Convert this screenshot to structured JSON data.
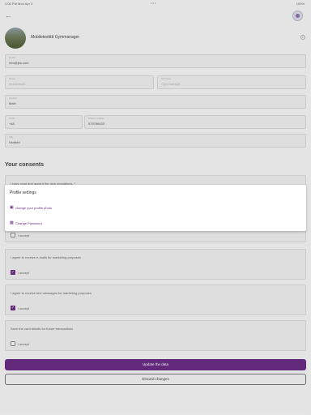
{
  "status_bar": {
    "time": "2:05 PM",
    "date": "Mon Apr 3",
    "dots": "•••",
    "battery": "100%"
  },
  "profile": {
    "name": "Mobiletesttttt Gymmanager"
  },
  "fields": {
    "email": {
      "label": "Email",
      "value": "mm@jhs.com"
    },
    "first_name": {
      "label": "Name",
      "value": "Mobiletesttt"
    },
    "last_name": {
      "label": "Surname",
      "value": "Gymmanager"
    },
    "gender": {
      "label": "Gender",
      "value": "Male"
    },
    "prefix": {
      "label": "Prefix",
      "value": "+48"
    },
    "phone": {
      "label": "Phone number",
      "value": "579786620"
    },
    "city": {
      "label": "City",
      "value": "Vsdddd"
    }
  },
  "consents": {
    "title": "Your consents",
    "items": [
      {
        "text": "I have read and accept the club regulations. *",
        "checkbox": ""
      },
      {
        "text": "",
        "checkbox": "I accept"
      },
      {
        "text": "I agree to receive e-mails for marketing purposes",
        "checkbox": "I accept"
      },
      {
        "text": "I agree to receive text messages for marketing purposes",
        "checkbox": "I accept"
      },
      {
        "text": "Save the card details for future transactions",
        "checkbox": "I accept"
      }
    ]
  },
  "buttons": {
    "update": "Update the data",
    "discard": "Discard changes"
  },
  "popup": {
    "title": "Profile settings",
    "items": [
      {
        "label": "change your profile photo",
        "icon": "image-icon"
      },
      {
        "label": "Change Password",
        "icon": "lock-icon"
      }
    ]
  },
  "colors": {
    "accent": "#6a2c82"
  }
}
